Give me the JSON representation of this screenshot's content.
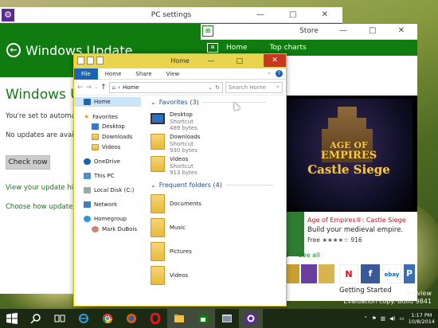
{
  "pc_settings": {
    "title": "PC settings",
    "header": "Windows Update",
    "heading": "Windows Update",
    "status_line": "You're set to automaticall",
    "no_updates": "No updates are available.",
    "check_now": "Check now",
    "link_history": "View your update history",
    "link_choose": "Choose how updates get",
    "controls": "— □ ✕",
    "accent": "#107c10"
  },
  "store": {
    "title": "Store",
    "controls": "— □ ✕",
    "nav": [
      "Home",
      "Top charts"
    ],
    "game_title_line1": "AGE OF",
    "game_title_line2": "EMPIRES",
    "game_subtitle": "Castle Siege",
    "app_name": "Age of Empires®: Castle Siege",
    "app_desc": "Build your medieval empire.",
    "price": "Free",
    "rating_stars": "★★★★☆",
    "rating_count": "916",
    "section_suffix": "ES",
    "see_all": "See all",
    "getting_started": "Getting Started",
    "tiles": [
      {
        "label": "N",
        "color": "#ffffff",
        "fg": "#e50914"
      },
      {
        "label": "f",
        "color": "#3b5998",
        "fg": "#ffffff"
      },
      {
        "label": "ebay",
        "color": "#ffffff",
        "fg": "#0064d2"
      },
      {
        "label": "P",
        "color": "#3a6fb5",
        "fg": "#ffffff"
      }
    ]
  },
  "explorer": {
    "title": "Home",
    "controls": "— □",
    "close": "✕",
    "ribbon": [
      "File",
      "Home",
      "Share",
      "View"
    ],
    "help": "?",
    "address": "Home",
    "search_placeholder": "Search Home",
    "nav": {
      "home": "Home",
      "favorites": "Favorites",
      "desktop": "Desktop",
      "downloads": "Downloads",
      "videos": "Videos",
      "onedrive": "OneDrive",
      "this_pc": "This PC",
      "local_disk": "Local Disk (C:)",
      "network": "Network",
      "homegroup": "Homegroup",
      "user": "Mark DuBois"
    },
    "favorites_header": "Favorites (3)",
    "favorites": [
      {
        "name": "Desktop",
        "type": "Shortcut",
        "size": "489 bytes"
      },
      {
        "name": "Downloads",
        "type": "Shortcut",
        "size": "930 bytes"
      },
      {
        "name": "Videos",
        "type": "Shortcut",
        "size": "913 bytes"
      }
    ],
    "frequent_header": "Frequent folders (4)",
    "frequent": [
      "Documents",
      "Music",
      "Pictures",
      "Videos"
    ]
  },
  "desktop": {
    "watermark_line1": "Preview",
    "watermark_line2": "Evaluation copy. Build 9841"
  },
  "taskbar": {
    "time": "1:17 PM",
    "date": "10/8/2014",
    "icons": [
      "windows-logo",
      "search",
      "task-view",
      "internet-explorer",
      "chrome",
      "firefox",
      "opera",
      "file-explorer",
      "store",
      "pc-settings-app",
      "settings"
    ]
  }
}
